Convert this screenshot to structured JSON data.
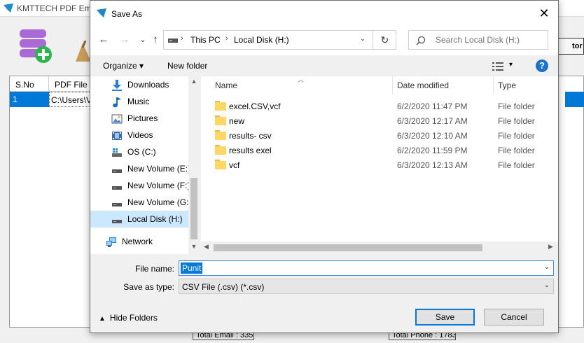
{
  "background_app": {
    "title": "KMTTECH PDF Ema",
    "right_button_label": "tor",
    "table": {
      "headers": [
        "S.No",
        "PDF File"
      ],
      "row1": {
        "sno": "1",
        "pdf_file": "C:\\Users\\Vi"
      }
    },
    "footer": {
      "total_email": "Total Email : 335",
      "total_phone": "Total Phone : 1783"
    }
  },
  "dialog": {
    "title": "Save As",
    "close_label": "✕",
    "nav": {
      "back": "←",
      "forward": "→",
      "recent": "⌄",
      "up": "↑"
    },
    "address": {
      "crumbs": [
        "This PC",
        "Local Disk (H:)"
      ],
      "separator": "›",
      "dropdown": "⌄",
      "refresh": "↻"
    },
    "search": {
      "placeholder": "Search Local Disk (H:)"
    },
    "toolbar": {
      "organize": "Organize ▾",
      "new_folder": "New folder",
      "view_arrow": "▾",
      "help": "?"
    },
    "nav_pane": {
      "items": [
        {
          "label": "Downloads",
          "icon": "download-icon"
        },
        {
          "label": "Music",
          "icon": "music-icon"
        },
        {
          "label": "Pictures",
          "icon": "pictures-icon"
        },
        {
          "label": "Videos",
          "icon": "videos-icon"
        },
        {
          "label": "OS (C:)",
          "icon": "os-drive-icon"
        },
        {
          "label": "New Volume (E:)",
          "icon": "drive-icon"
        },
        {
          "label": "New Volume (F:)",
          "icon": "drive-icon"
        },
        {
          "label": "New Volume (G:)",
          "icon": "drive-icon"
        },
        {
          "label": "Local Disk (H:)",
          "icon": "drive-icon",
          "selected": true
        },
        {
          "label": "Network",
          "icon": "network-icon"
        }
      ]
    },
    "file_list": {
      "columns": {
        "name": "Name",
        "date": "Date modified",
        "type": "Type"
      },
      "rows": [
        {
          "name": "excel.CSV,vcf",
          "date": "6/2/2020 11:47 PM",
          "type": "File folder"
        },
        {
          "name": "new",
          "date": "6/3/2020 12:17 AM",
          "type": "File folder"
        },
        {
          "name": "results- csv",
          "date": "6/3/2020 12:10 AM",
          "type": "File folder"
        },
        {
          "name": "results exel",
          "date": "6/2/2020 11:59 PM",
          "type": "File folder"
        },
        {
          "name": "vcf",
          "date": "6/3/2020 12:13 AM",
          "type": "File folder"
        }
      ]
    },
    "file_name": {
      "label": "File name:",
      "value": "Punit"
    },
    "save_as_type": {
      "label": "Save as type:",
      "value": "CSV File (.csv) (*.csv)"
    },
    "hide_folders": "Hide Folders",
    "buttons": {
      "save": "Save",
      "cancel": "Cancel"
    },
    "colors": {
      "accent": "#0078d7",
      "selection": "#cce8ff",
      "folder": "#ffd766"
    }
  }
}
